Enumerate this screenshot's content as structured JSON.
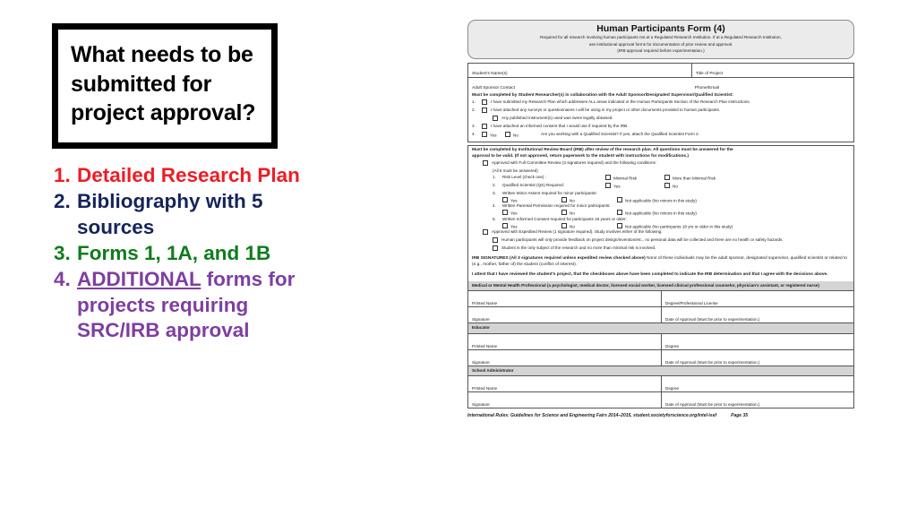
{
  "slide": {
    "title": "What needs to be submitted for project approval?",
    "points": [
      {
        "num": "1.",
        "text": "Detailed Research Plan",
        "color": "#EE1C25"
      },
      {
        "num": "2.",
        "text": "Bibliography with 5 sources",
        "color": "#16245A"
      },
      {
        "num": "3.",
        "text": "Forms 1, 1A, and 1B",
        "color": "#107B1D"
      },
      {
        "num": "4.",
        "emphasis": "ADDITIONAL",
        "text": " forms for projects requiring SRC/IRB approval",
        "color": "#7E3FA0"
      }
    ]
  },
  "form": {
    "header": {
      "title": "Human Participants Form (4)",
      "line1": "Required for all research involving human participants not at a Regulated Research Institution. If at a Regulated Research Institution,",
      "line2": "use institutional approval forms for documentation of prior review and approval.",
      "line3": "(IRB approval required before experimentation.)"
    },
    "fields": {
      "students_name": "Student's Name(s)",
      "title_of_project": "Title of Project",
      "adult_sponsor_contact": "Adult Sponsor Contact",
      "phone_email": "Phone/Email"
    },
    "student_section": {
      "heading": "Must be completed by Student Researcher(s) in collaboration with the Adult Sponsor/Designated Supervisor/Qualified Scientist:",
      "items": [
        {
          "idx": "1.",
          "text": "I have submitted my Research Plan which addresses ALL areas indicated in the Human Participants Section of the Research Plan instructions."
        },
        {
          "idx": "2.",
          "text": "I have attached any surveys or questionnaires I will be using in my project or other documents provided to human participants."
        },
        {
          "idx": "",
          "sub": true,
          "text": "Any published instrument(s) used was /were legally obtained."
        },
        {
          "idx": "3.",
          "text": "I have attached an informed consent that I would use if required by the IRB."
        }
      ],
      "item4": {
        "idx": "4.",
        "yes": "Yes",
        "no": "No",
        "text": "Are you working with a Qualified Scientist? If yes, attach the Qualified Scientist Form 2."
      }
    },
    "irb_section": {
      "heading1": "Must be completed by Institutional Review Board (IRB) after review of the research plan.  All questions must be answered for the",
      "heading2": "approval to be valid.  (If not approved, return paperwork to the student with instructions for modifications.)",
      "full_review": "Approved  with Full Committee Review (3 signatures required) and the following conditions:",
      "all5": "(All 5 must be answered)",
      "q1": {
        "idx": "1.",
        "label": "Risk Level (check one) :",
        "opt1": "Minimal Risk",
        "opt2": "More than Minimal Risk"
      },
      "q2": {
        "idx": "2.",
        "label": "Qualified Scientist (QS) Required:",
        "opt1": "Yes",
        "opt2": "No"
      },
      "q3": {
        "idx": "3.",
        "label": "Written Minor Assent required for minor participants:",
        "opt1": "Yes",
        "opt2": "No",
        "opt3": "Not applicable (No minors in this study)"
      },
      "q4": {
        "idx": "4.",
        "label": "Written Parental Permission required for minor participants:",
        "opt1": "Yes",
        "opt2": "No",
        "opt3": "Not applicable (No minors in this study)"
      },
      "q5": {
        "idx": "5.",
        "label": "Written Informed Consent required for participants 18 years or older:",
        "opt1": "Yes",
        "opt2": "No",
        "opt3": "Not applicable (No participants 18 yrs or older in this study)"
      },
      "expedited": "Approved  with Expedited Review (1 signature required). Study involves either of the following:",
      "exp1": "Human participants will only provide feedback on project design/invention/etc., no personal data will be collected and there are no health or safety hazards.",
      "exp2": "Student is the only subject of the research and no more than minimal risk is involved.",
      "signatures_bold": "IRB SIGNATURES  (All 3 signatures required unless expedited review checked above)",
      "signatures_rest": " None of these individuals may be the adult sponsor, designated supervisor, qualified scientist or related to (e.g., mother, father of) the student (conflict of interest).",
      "attest": "I attest that I have reviewed the student's project, that the checkboxes above have been completed to indicate the IRB determination and that I agree with the decisions above."
    },
    "signature_blocks": [
      {
        "band": "Medical or Mental Health Professional (a psychologist, medical doctor, licensed social worker, licensed clinical professional counselor, physician's assistant, or registered nurse)",
        "rows": [
          {
            "left": "Printed Name",
            "right": "Degree/Professional License"
          },
          {
            "left": "Signature",
            "right": "Date of Approval (Must be prior to experimentation.)"
          }
        ]
      },
      {
        "band": "Educator",
        "rows": [
          {
            "left": "Printed Name",
            "right": "Degree"
          },
          {
            "left": "Signature",
            "right": "Date of Approval (Must be prior to experimentation.)"
          }
        ]
      },
      {
        "band": "School Administrator",
        "rows": [
          {
            "left": "Printed Name",
            "right": "Degree"
          },
          {
            "left": "Signature",
            "right": "Date of Approval (Must be prior to experimentation.)"
          }
        ]
      }
    ],
    "footer": {
      "text": "International Rules: Guidelines for Science and Engineering Fairs 2014–2015, student.societyforscience.org/intel-isef",
      "page": "Page 35"
    }
  }
}
